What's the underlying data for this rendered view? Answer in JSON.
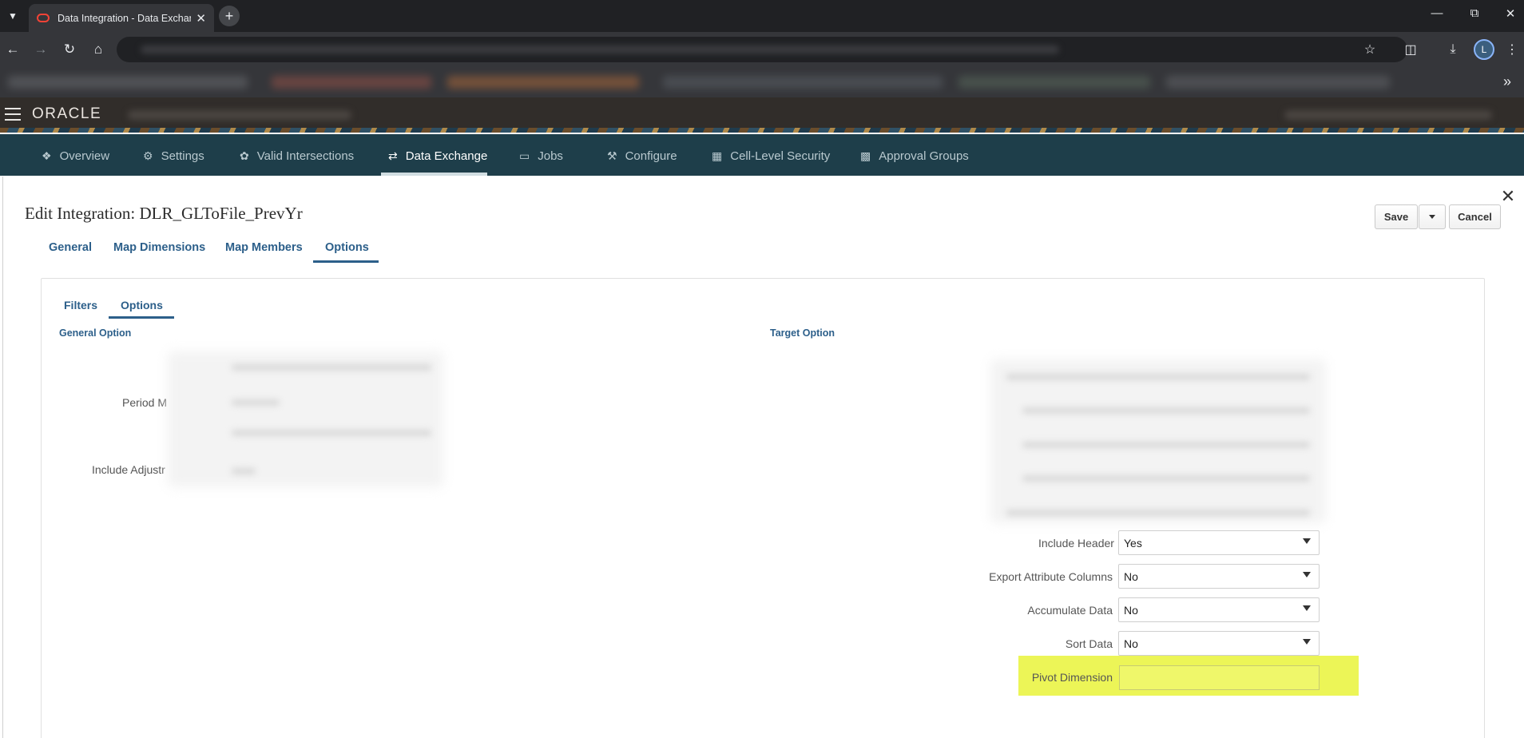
{
  "browser": {
    "tab_title": "Data Integration - Data Exchange",
    "tab_close": "✕",
    "new_tab": "+",
    "profile_initial": "L"
  },
  "app": {
    "logo": "ORACLE"
  },
  "nav": {
    "items": [
      {
        "label": "Overview",
        "icon": "overview-icon"
      },
      {
        "label": "Settings",
        "icon": "gear-icon"
      },
      {
        "label": "Valid Intersections",
        "icon": "intersections-icon"
      },
      {
        "label": "Data Exchange",
        "icon": "exchange-icon",
        "active": true
      },
      {
        "label": "Jobs",
        "icon": "clipboard-icon"
      },
      {
        "label": "Configure",
        "icon": "tools-icon"
      },
      {
        "label": "Cell-Level Security",
        "icon": "grid-security-icon"
      },
      {
        "label": "Approval Groups",
        "icon": "group-icon"
      }
    ]
  },
  "dialog": {
    "title": "Edit Integration: DLR_GLToFile_PrevYr",
    "save_label": "Save",
    "cancel_label": "Cancel",
    "close": "✕",
    "tabs": [
      "General",
      "Map Dimensions",
      "Map Members",
      "Options"
    ],
    "active_tab": "Options",
    "subtabs": [
      "Filters",
      "Options"
    ],
    "active_subtab": "Options"
  },
  "general_option": {
    "title": "General Option",
    "labels": [
      "Period M",
      "Include Adjustr"
    ]
  },
  "target_option": {
    "title": "Target Option",
    "fields": [
      {
        "label": "Include Header",
        "value": "Yes"
      },
      {
        "label": "Export Attribute Columns",
        "value": "No"
      },
      {
        "label": "Accumulate Data",
        "value": "No"
      },
      {
        "label": "Sort Data",
        "value": "No"
      }
    ],
    "pivot": {
      "label": "Pivot Dimension",
      "value": ""
    }
  },
  "colors": {
    "accent": "#2c5f8a",
    "navbar": "#1e3e4a",
    "header": "#312d2a",
    "highlight": "#ecf557"
  }
}
